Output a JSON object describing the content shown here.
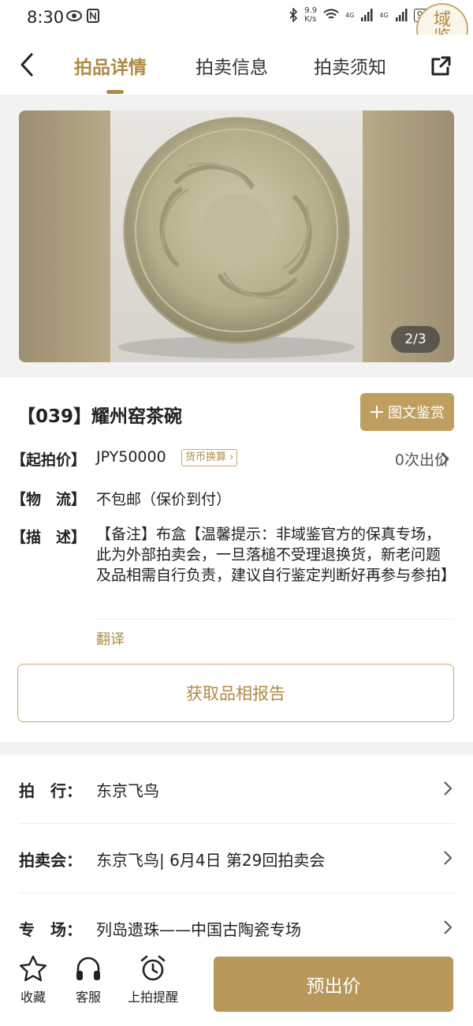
{
  "status_bar": {
    "time": "8:30",
    "net_speed": "9.9\nK/s",
    "net1": "4G",
    "net2": "4G",
    "battery": "92",
    "seal_text": "域鉴"
  },
  "nav": {
    "tabs": [
      {
        "label": "拍品详情",
        "active": true
      },
      {
        "label": "拍卖信息",
        "active": false
      },
      {
        "label": "拍卖须知",
        "active": false
      }
    ]
  },
  "gallery": {
    "counter": "2/3",
    "current": 2,
    "total": 3
  },
  "lot": {
    "title": "【039】耀州窑茶碗",
    "appraise_label": "图文鉴赏",
    "start_price_label": "【起拍价】",
    "start_price": "JPY50000",
    "currency_tag": "货币换算",
    "bids": "0次出价",
    "logistics_label": "【物　流】",
    "logistics": "不包邮（保价到付）",
    "desc_label": "【描　述】",
    "description": "【备注】布盒【温馨提示：非域鉴官方的保真专场，此为外部拍卖会，一旦落槌不受理退换货，新老问题及品相需自行负责，建议自行鉴定判断好再参与参拍】",
    "translate": "翻译",
    "report_button": "获取品相报告"
  },
  "meta": {
    "rows": [
      {
        "label": "拍　行：",
        "value": "东京飞鸟"
      },
      {
        "label": "拍卖会：",
        "value": "东京飞鸟| 6月4日 第29回拍卖会"
      },
      {
        "label": "专　场：",
        "value": "列岛遗珠——中国古陶瓷专场"
      }
    ]
  },
  "bottom_bar": {
    "favorite": "收藏",
    "service": "客服",
    "remind": "上拍提醒",
    "bid_button": "预出价"
  },
  "colors": {
    "accent": "#b08a45",
    "button_gold": "#b8975a"
  }
}
